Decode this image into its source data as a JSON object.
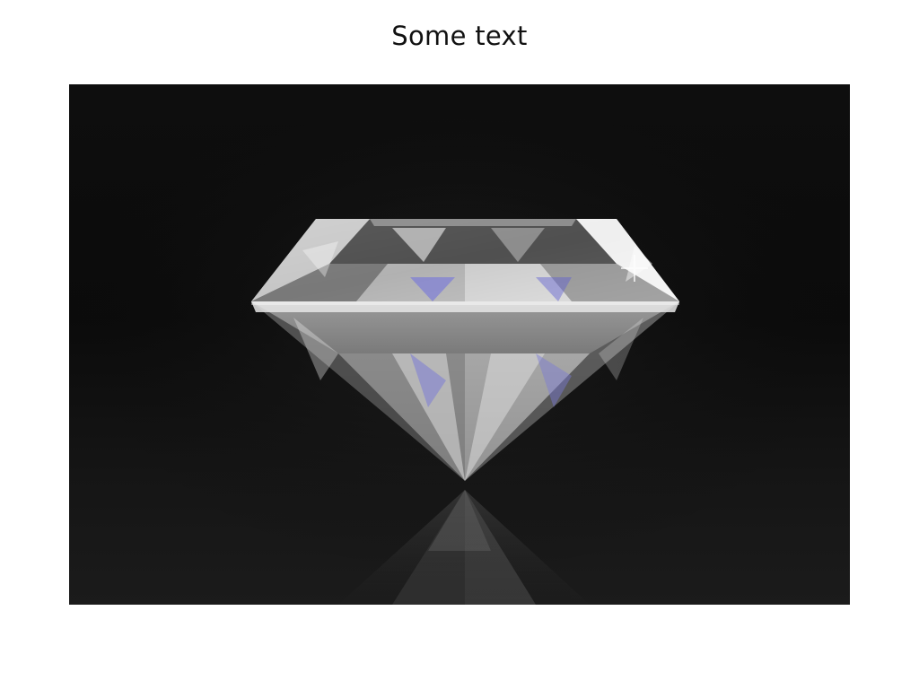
{
  "page": {
    "title": "Some text"
  },
  "image": {
    "subject": "diamond-icon",
    "background_color": "#0d0d0d"
  }
}
